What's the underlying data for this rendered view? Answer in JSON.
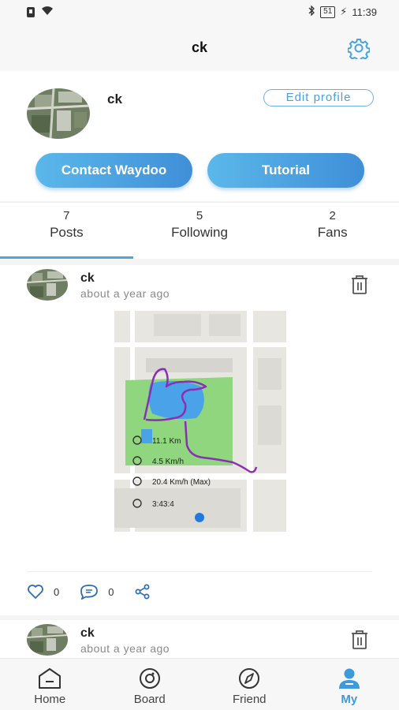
{
  "status_bar": {
    "time": "11:39",
    "battery": "51"
  },
  "header": {
    "title": "ck"
  },
  "profile": {
    "name": "ck",
    "edit_label": "Edit profile",
    "contact_label": "Contact Waydoo",
    "tutorial_label": "Tutorial"
  },
  "stats": [
    {
      "count": "7",
      "label": "Posts"
    },
    {
      "count": "5",
      "label": "Following"
    },
    {
      "count": "2",
      "label": "Fans"
    }
  ],
  "posts": [
    {
      "author": "ck",
      "time": "about a year ago",
      "likes": "0",
      "comments": "0",
      "map": {
        "distance": "11.1 Km",
        "avg_speed": "4.5 Km/h",
        "max_speed": "20.4 Km/h (Max)",
        "duration": "3:43:4"
      }
    },
    {
      "author": "ck",
      "time": "about a year ago"
    }
  ],
  "nav": [
    {
      "label": "Home",
      "icon": "home-icon"
    },
    {
      "label": "Board",
      "icon": "board-icon"
    },
    {
      "label": "Friend",
      "icon": "compass-icon"
    },
    {
      "label": "My",
      "icon": "user-icon"
    }
  ],
  "colors": {
    "accent": "#3f9ad9",
    "route": "#8a2fb5",
    "park": "#8fd67e",
    "water": "#4aa3e8"
  }
}
